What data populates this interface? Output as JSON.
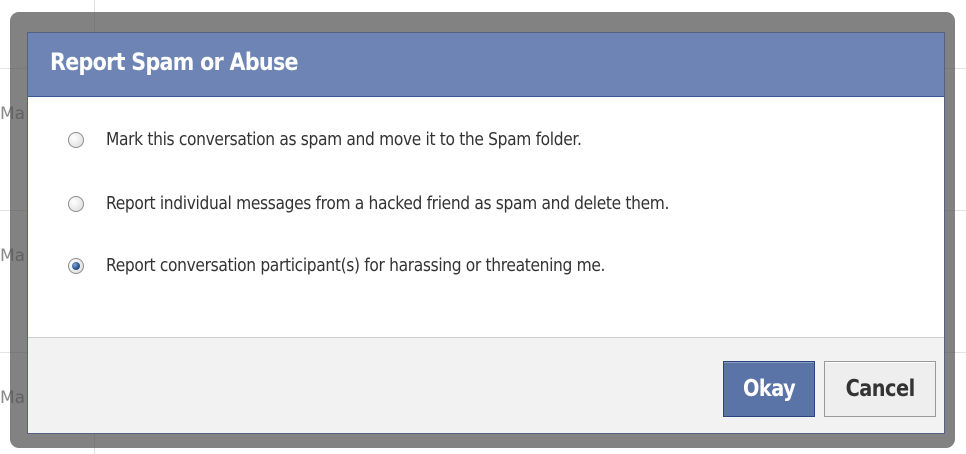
{
  "background": {
    "row_snippets": [
      "Ma",
      "Ma",
      "Ma"
    ]
  },
  "dialog": {
    "title": "Report Spam or Abuse",
    "options": [
      {
        "label": "Mark this conversation as spam and move it to the Spam folder.",
        "selected": false
      },
      {
        "label": "Report individual messages from a hacked friend as spam and delete them.",
        "selected": false
      },
      {
        "label": "Report conversation participant(s) for harassing or threatening me.",
        "selected": true
      }
    ],
    "buttons": {
      "okay_label": "Okay",
      "cancel_label": "Cancel"
    }
  },
  "colors": {
    "header_bg": "#6d84b4",
    "primary_button": "#5b74a8",
    "footer_bg": "#f2f2f2"
  },
  "icons": {
    "unselected_radio": "radio-unchecked-icon",
    "selected_radio": "radio-checked-icon"
  }
}
